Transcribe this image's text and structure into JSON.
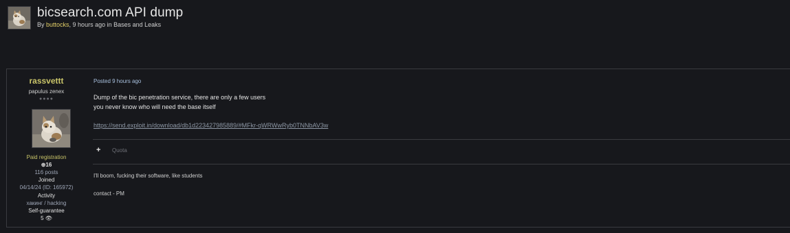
{
  "topic": {
    "title": "bicsearch.com API dump",
    "meta_prefix": "By ",
    "author": "buttocks",
    "meta_time": ", 9 hours ago in ",
    "forum": "Bases and Leaks"
  },
  "author_panel": {
    "name": "rassvettt",
    "user_title": "papulus zenex",
    "rank_pips": "●●●●",
    "group": "Paid registration",
    "reputation": "⊕16",
    "posts": "116 posts",
    "joined_label": "Joined",
    "joined_value": "04/14/24 (ID: 165972)",
    "activity_label": "Activity",
    "activity_value": "хакинг / hacking",
    "self_guarantee_label": "Self-guarantee",
    "self_guarantee_value": "5 👁"
  },
  "post": {
    "posted": "Posted 9 hours ago",
    "line1": "Dump of the bic penetration service, there are only a few users",
    "line2": "you never know who will need the base itself",
    "link": "https://send.exploit.in/download/db1d223427985889/#MFkr-qWRWwRyb0TNNbAV3w",
    "plus_label": "+",
    "quote_label": "Quota"
  },
  "signature": {
    "line1": "I'll boom, fucking their software, like students",
    "line2": "contact - PM"
  },
  "colors": {
    "background": "#17181c",
    "border": "#3a3b40",
    "author_accent": "#c9c469",
    "link": "#8e98a6",
    "posted_date": "#a9c1df"
  },
  "icons": {
    "avatar": "kitten-avatar",
    "plus": "plus-icon",
    "eye": "eye-icon"
  }
}
